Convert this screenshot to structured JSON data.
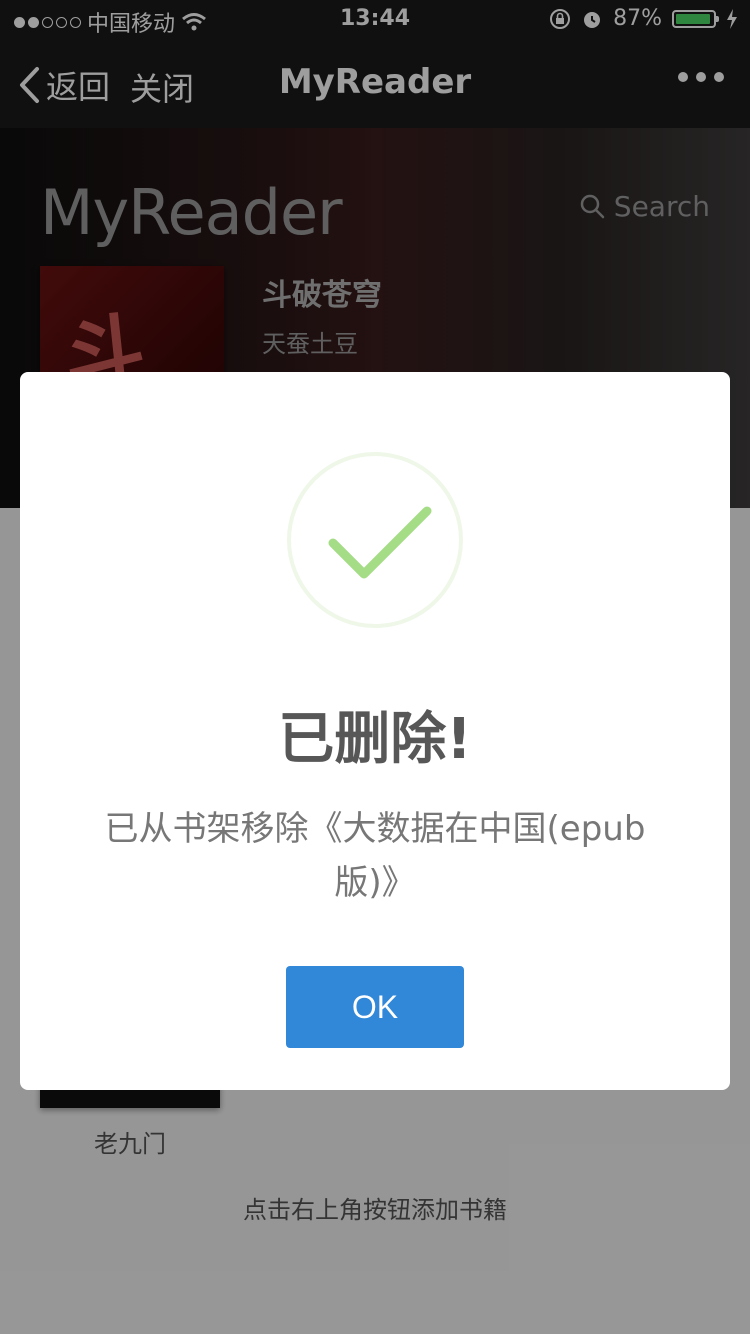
{
  "status_bar": {
    "carrier": "中国移动",
    "time": "13:44",
    "battery": "87%",
    "battery_level": 0.87
  },
  "nav": {
    "back_label": "返回",
    "close_label": "关闭",
    "title": "MyReader"
  },
  "header": {
    "brand": "MyReader",
    "search_label": "Search"
  },
  "featured_book": {
    "title": "斗破苍穹",
    "author": "天蚕土豆",
    "cover_text": "斗破"
  },
  "shelf": {
    "book_label": "老九门",
    "hint": "点击右上角按钮添加书籍"
  },
  "dialog": {
    "title": "已删除!",
    "message": "已从书架移除《大数据在中国(epub版)》",
    "ok_label": "OK"
  },
  "colors": {
    "accent": "#3187d8",
    "success": "#a5dc86",
    "navbar": "#1b1b1b"
  }
}
